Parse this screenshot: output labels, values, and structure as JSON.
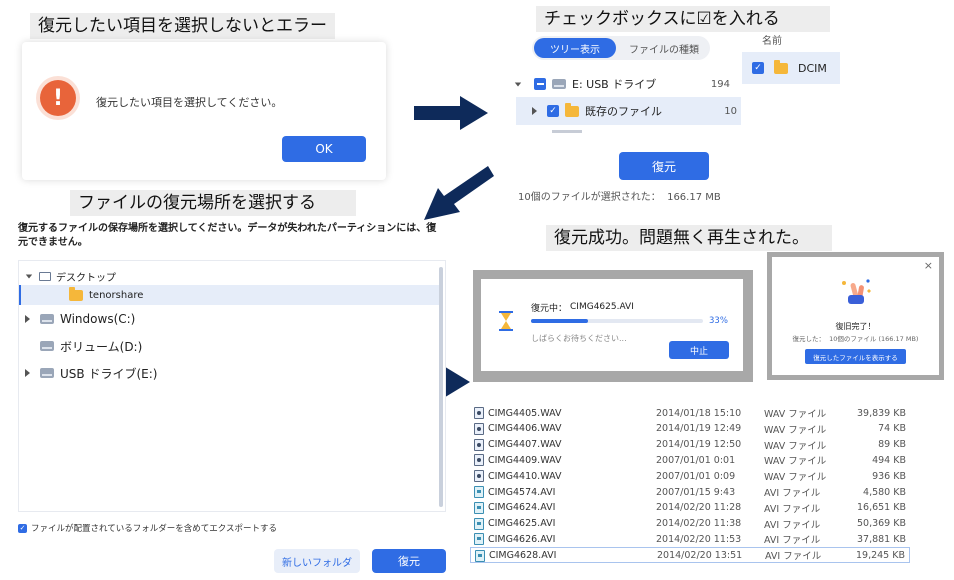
{
  "captions": {
    "error": "復元したい項目を選択しないとエラー",
    "checkbox": "チェックボックスに☑を入れる",
    "location": "ファイルの復元場所を選択する",
    "success": "復元成功。問題無く再生された。"
  },
  "error_dialog": {
    "message": "復元したい項目を選択してください。",
    "ok_label": "OK",
    "icon": "warning-icon",
    "accent": "#e8643a"
  },
  "select_panel": {
    "tabs": [
      "ツリー表示",
      "ファイルの種類"
    ],
    "drive_label": "E: USB ドライブ",
    "drive_count": "194",
    "folder_label": "既存のファイル",
    "folder_count": "10",
    "right_header": "名前",
    "right_item": "DCIM",
    "recover_label": "復元",
    "selection_info": "10個のファイルが選択された：  166.17 MB"
  },
  "location_dialog": {
    "instruction": "復元するファイルの保存場所を選択してください。データが失われたパーティションには、復元できません。",
    "tree": {
      "desktop": "デスクトップ",
      "tenorshare": "tenorshare",
      "drive_c": "Windows(C:)",
      "drive_d": "ボリューム(D:)",
      "drive_e": "USB ドライブ(E:)"
    },
    "export_option": "ファイルが配置されているフォルダーを含めてエクスポートする",
    "new_folder_label": "新しいフォルダ",
    "recover_label": "復元"
  },
  "progress_dialog": {
    "title_prefix": "復元中：",
    "file": "CIMG4625.AVI",
    "percent_label": "33%",
    "percent": 33,
    "wait": "しばらくお待ちください...",
    "stop_label": "中止"
  },
  "complete_dialog": {
    "title": "復旧完了！",
    "info": "復元した：  10個のファイル (166.17 MB)",
    "show_label": "復元したファイルを表示する",
    "close": "×"
  },
  "files": [
    {
      "name": "CIMG4405.WAV",
      "date": "2014/01/18 15:10",
      "type": "WAV ファイル",
      "size": "39,839 KB",
      "kind": "wav"
    },
    {
      "name": "CIMG4406.WAV",
      "date": "2014/01/19 12:49",
      "type": "WAV ファイル",
      "size": "74 KB",
      "kind": "wav"
    },
    {
      "name": "CIMG4407.WAV",
      "date": "2014/01/19 12:50",
      "type": "WAV ファイル",
      "size": "89 KB",
      "kind": "wav"
    },
    {
      "name": "CIMG4409.WAV",
      "date": "2007/01/01 0:01",
      "type": "WAV ファイル",
      "size": "494 KB",
      "kind": "wav"
    },
    {
      "name": "CIMG4410.WAV",
      "date": "2007/01/01 0:09",
      "type": "WAV ファイル",
      "size": "936 KB",
      "kind": "wav"
    },
    {
      "name": "CIMG4574.AVI",
      "date": "2007/01/15 9:43",
      "type": "AVI ファイル",
      "size": "4,580 KB",
      "kind": "avi"
    },
    {
      "name": "CIMG4624.AVI",
      "date": "2014/02/20 11:28",
      "type": "AVI ファイル",
      "size": "16,651 KB",
      "kind": "avi"
    },
    {
      "name": "CIMG4625.AVI",
      "date": "2014/02/20 11:38",
      "type": "AVI ファイル",
      "size": "50,369 KB",
      "kind": "avi"
    },
    {
      "name": "CIMG4626.AVI",
      "date": "2014/02/20 11:53",
      "type": "AVI ファイル",
      "size": "37,881 KB",
      "kind": "avi"
    },
    {
      "name": "CIMG4628.AVI",
      "date": "2014/02/20 13:51",
      "type": "AVI ファイル",
      "size": "19,245 KB",
      "kind": "avi"
    }
  ],
  "colors": {
    "primary": "#2f6ce4",
    "highlight": "#e6edf9",
    "arrow": "#0e2a5a"
  }
}
